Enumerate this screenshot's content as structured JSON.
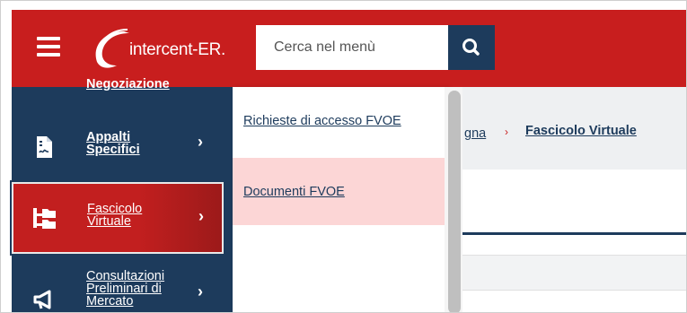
{
  "header": {
    "logo_text": "intercent-ER.",
    "search_placeholder": "Cerca nel menù",
    "colors": {
      "primary_red": "#c81e1e",
      "navy": "#1d3b5c"
    }
  },
  "sidebar": {
    "items": [
      {
        "label": "Negoziazione",
        "icon": "handshake-icon",
        "active": false
      },
      {
        "label_line1": "Appalti",
        "label_line2": "Specifici",
        "icon": "document-signature-icon",
        "active": false,
        "chevron": "›"
      },
      {
        "label_line1": "Fascicolo",
        "label_line2": "Virtuale",
        "icon": "folder-tree-icon",
        "active": true,
        "chevron": "›"
      },
      {
        "label_line1": "Consultazioni",
        "label_line2": "Preliminari di",
        "label_line3": "Mercato",
        "icon": "megaphone-icon",
        "active": false,
        "chevron": "›"
      }
    ]
  },
  "submenu": {
    "items": [
      {
        "label": "Richieste di accesso FVOE",
        "highlighted": false
      },
      {
        "label": "Documenti FVOE",
        "highlighted": true
      }
    ]
  },
  "breadcrumb": {
    "partial": "gna",
    "separator": "›",
    "current": "Fascicolo Virtuale"
  }
}
